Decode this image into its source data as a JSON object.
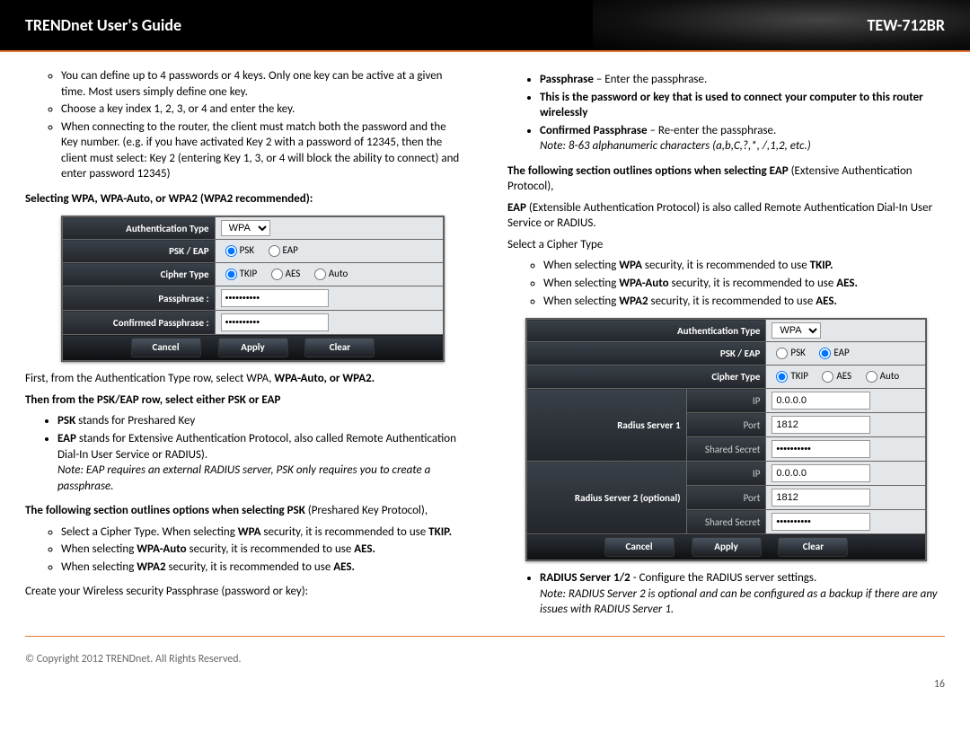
{
  "header": {
    "left": "TRENDnet User's Guide",
    "right": "TEW-712BR"
  },
  "col1": {
    "intro": [
      "You can define up to 4 passwords or 4 keys. Only one key can be active at a given time. Most users simply define one key.",
      "Choose a key index 1, 2, 3, or 4 and enter the key.",
      "When connecting to the router, the client must match both the password and the Key number. (e.g. if you have activated Key 2 with a password of 12345, then the client must select: Key 2 (entering Key 1, 3, or 4 will block the ability to connect) and enter password 12345)"
    ],
    "h1": "Selecting WPA, WPA-Auto, or WPA2 (WPA2 recommended):",
    "dlg1": {
      "auth_label": "Authentication Type",
      "auth": "WPA",
      "pskeap_label": "PSK / EAP",
      "psk": "PSK",
      "eap": "EAP",
      "cipher_label": "Cipher Type",
      "tkip": "TKIP",
      "aes": "AES",
      "auto": "Auto",
      "pass_label": "Passphrase :",
      "pass": "••••••••••",
      "cpass_label": "Confirmed Passphrase :",
      "cpass": "••••••••••",
      "cancel": "Cancel",
      "apply": "Apply",
      "clear": "Clear"
    },
    "afterDlg": "First, from the Authentication Type row, select WPA, ",
    "afterDlgB": "WPA-Auto, or WPA2.",
    "h2": "Then from the PSK/EAP row, select either PSK or EAP",
    "pskLine1": "PSK",
    "pskLine1b": " stands for Preshared Key",
    "eapLine1": "EAP",
    "eapLine1b": " stands for Extensive Authentication Protocol, also called Remote Authentication Dial-In User Service or RADIUS).",
    "noteEap": "Note: EAP requires an external RADIUS server, PSK only requires you to create a passphrase.",
    "h3a": "The following section outlines options when selecting PSK ",
    "h3b": "(Preshared Key Protocol),",
    "cipherIntro": "Select a Cipher Type. When selecting ",
    "cipherB": "WPA",
    "cipherC": " security, it is recommended to use ",
    "cipherD": "TKIP.",
    "wpaAuto": "When selecting ",
    "wpaAutoB": "WPA-Auto",
    "wpaAutoC": " security, it is recommended to use ",
    "wpaAutoD": "AES.",
    "wpa2": "When selecting ",
    "wpa2B": "WPA2",
    "wpa2C": " security, it is recommended to use ",
    "wpa2D": "AES.",
    "createPass": "Create your Wireless security Passphrase (password or key):"
  },
  "col2": {
    "pass": "Passphrase",
    "passT": " – Enter the passphrase.",
    "passDesc": "This is the password or key that is used to connect your computer to this router wirelessly",
    "cpass": "Confirmed Passphrase",
    "cpassT": " – Re-enter the passphrase.",
    "note": "Note: 8-63 alphanumeric characters (a,b,C,?,*, /,1,2, etc.)",
    "sect": "The following section outlines options when selecting EAP ",
    "sectB": "(Extensive Authentication Protocol),",
    "eapDesc1": "EAP",
    "eapDesc2": " (Extensible Authentication Protocol) is also called Remote Authentication Dial-In User Service or RADIUS.",
    "selCipher": "Select a Cipher Type",
    "wpa": "When selecting ",
    "wpaB": "WPA",
    "wpaC": " security, it is recommended to use ",
    "wpaD": "TKIP.",
    "wpaAuto": "When selecting ",
    "wpaAutoB": "WPA-Auto",
    "wpaAutoC": " security, it is recommended to use ",
    "wpaAutoD": "AES.",
    "wpa2": "When selecting ",
    "wpa2B": "WPA2",
    "wpa2C": " security, it is recommended to use ",
    "wpa2D": "AES.",
    "dlg2": {
      "auth_label": "Authentication Type",
      "auth": "WPA",
      "pskeap_label": "PSK / EAP",
      "psk": "PSK",
      "eap": "EAP",
      "cipher_label": "Cipher Type",
      "tkip": "TKIP",
      "aes": "AES",
      "auto": "Auto",
      "r1_label": "Radius Server 1",
      "r2_label": "Radius Server 2 (optional)",
      "ip_label": "IP",
      "port_label": "Port",
      "ss_label": "Shared Secret",
      "ip": "0.0.0.0",
      "port": "1812",
      "ss": "••••••••••",
      "cancel": "Cancel",
      "apply": "Apply",
      "clear": "Clear"
    },
    "radius": "RADIUS Server 1/2",
    "radiusT": " - Configure the RADIUS server settings.",
    "radiusNote": "Note: RADIUS Server 2 is optional and can be configured as a backup if there are any issues with RADIUS Server 1."
  },
  "footer": {
    "copy": "© Copyright 2012 TRENDnet. All Rights Reserved.",
    "page": "16"
  }
}
